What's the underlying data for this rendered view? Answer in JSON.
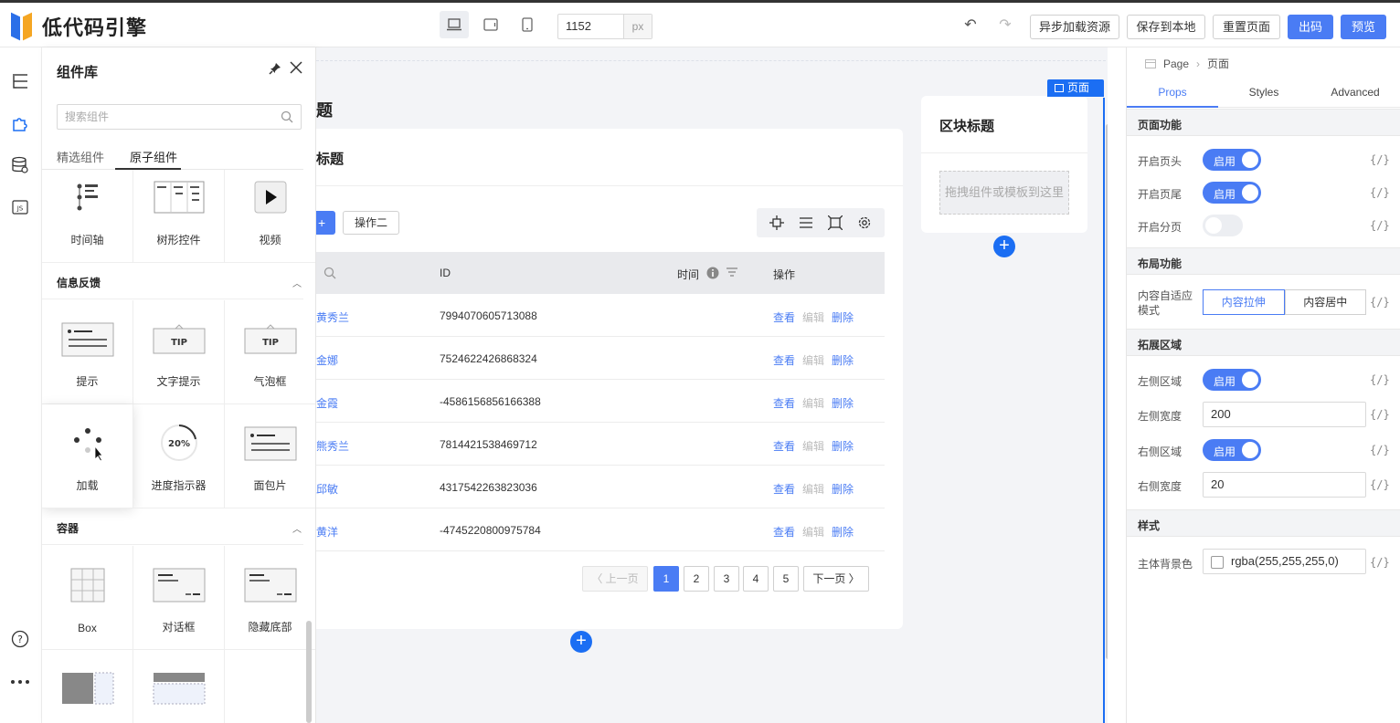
{
  "app": {
    "title": "低代码引擎"
  },
  "toolbar": {
    "width_value": "1152",
    "width_unit": "px",
    "async_load": "异步加载资源",
    "save_local": "保存到本地",
    "reset_page": "重置页面",
    "export_code": "出码",
    "preview": "预览"
  },
  "panel": {
    "title": "组件库",
    "search_placeholder": "搜索组件",
    "tabs": [
      "精选组件",
      "原子组件"
    ],
    "top_items": [
      "时间轴",
      "树形控件",
      "视频"
    ],
    "sections": [
      {
        "title": "信息反馈",
        "items": [
          "提示",
          "文字提示",
          "气泡框",
          "加载",
          "进度指示器",
          "面包片"
        ]
      },
      {
        "title": "容器",
        "items": [
          "Box",
          "对话框",
          "隐藏底部"
        ]
      }
    ],
    "tip_text": "TIP",
    "progress_text": "20%"
  },
  "canvas": {
    "page_title": "题",
    "card_title": "标题",
    "op1": "+",
    "op2": "操作二",
    "columns": {
      "id": "ID",
      "time": "时间",
      "action": "操作"
    },
    "rows": [
      {
        "name": "黄秀兰",
        "id": "7994070605713088"
      },
      {
        "name": "金娜",
        "id": "7524622426868324"
      },
      {
        "name": "金霞",
        "id": "-4586156856166388"
      },
      {
        "name": "熊秀兰",
        "id": "7814421538469712"
      },
      {
        "name": "邱敏",
        "id": "4317542263823036"
      },
      {
        "name": "黄洋",
        "id": "-4745220800975784"
      }
    ],
    "actions": {
      "view": "查看",
      "edit": "编辑",
      "delete": "删除"
    },
    "pager": {
      "prev": "上一页",
      "next": "下一页",
      "pages": [
        "1",
        "2",
        "3",
        "4",
        "5"
      ]
    },
    "block_title": "区块标题",
    "drop_hint": "拖拽组件或模板到这里",
    "page_tag": "页面",
    "add": "+"
  },
  "props": {
    "breadcrumb": [
      "Page",
      "页面"
    ],
    "tabs": [
      "Props",
      "Styles",
      "Advanced"
    ],
    "sections": {
      "page": "页面功能",
      "layout": "布局功能",
      "extend": "拓展区域",
      "style": "样式"
    },
    "labels": {
      "header": "开启页头",
      "footer": "开启页尾",
      "paging": "开启分页",
      "adapt": "内容自适应模式",
      "left": "左侧区域",
      "left_width": "左侧宽度",
      "right": "右侧区域",
      "right_width": "右侧宽度",
      "bg": "主体背景色"
    },
    "switch_on": "启用",
    "expr": "{/}",
    "seg": [
      "内容拉伸",
      "内容居中"
    ],
    "left_width": "200",
    "right_width": "20",
    "bg_color": "rgba(255,255,255,0)"
  }
}
